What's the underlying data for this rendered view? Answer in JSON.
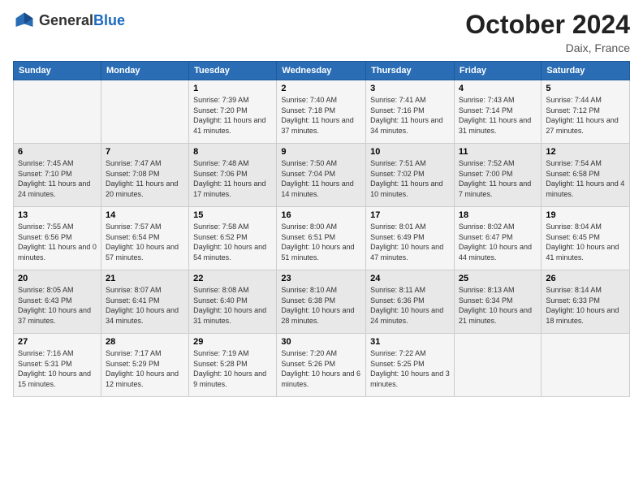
{
  "header": {
    "logo_line1": "General",
    "logo_line2": "Blue",
    "month": "October 2024",
    "location": "Daix, France"
  },
  "days_of_week": [
    "Sunday",
    "Monday",
    "Tuesday",
    "Wednesday",
    "Thursday",
    "Friday",
    "Saturday"
  ],
  "weeks": [
    [
      {
        "num": "",
        "sunrise": "",
        "sunset": "",
        "daylight": ""
      },
      {
        "num": "",
        "sunrise": "",
        "sunset": "",
        "daylight": ""
      },
      {
        "num": "1",
        "sunrise": "Sunrise: 7:39 AM",
        "sunset": "Sunset: 7:20 PM",
        "daylight": "Daylight: 11 hours and 41 minutes."
      },
      {
        "num": "2",
        "sunrise": "Sunrise: 7:40 AM",
        "sunset": "Sunset: 7:18 PM",
        "daylight": "Daylight: 11 hours and 37 minutes."
      },
      {
        "num": "3",
        "sunrise": "Sunrise: 7:41 AM",
        "sunset": "Sunset: 7:16 PM",
        "daylight": "Daylight: 11 hours and 34 minutes."
      },
      {
        "num": "4",
        "sunrise": "Sunrise: 7:43 AM",
        "sunset": "Sunset: 7:14 PM",
        "daylight": "Daylight: 11 hours and 31 minutes."
      },
      {
        "num": "5",
        "sunrise": "Sunrise: 7:44 AM",
        "sunset": "Sunset: 7:12 PM",
        "daylight": "Daylight: 11 hours and 27 minutes."
      }
    ],
    [
      {
        "num": "6",
        "sunrise": "Sunrise: 7:45 AM",
        "sunset": "Sunset: 7:10 PM",
        "daylight": "Daylight: 11 hours and 24 minutes."
      },
      {
        "num": "7",
        "sunrise": "Sunrise: 7:47 AM",
        "sunset": "Sunset: 7:08 PM",
        "daylight": "Daylight: 11 hours and 20 minutes."
      },
      {
        "num": "8",
        "sunrise": "Sunrise: 7:48 AM",
        "sunset": "Sunset: 7:06 PM",
        "daylight": "Daylight: 11 hours and 17 minutes."
      },
      {
        "num": "9",
        "sunrise": "Sunrise: 7:50 AM",
        "sunset": "Sunset: 7:04 PM",
        "daylight": "Daylight: 11 hours and 14 minutes."
      },
      {
        "num": "10",
        "sunrise": "Sunrise: 7:51 AM",
        "sunset": "Sunset: 7:02 PM",
        "daylight": "Daylight: 11 hours and 10 minutes."
      },
      {
        "num": "11",
        "sunrise": "Sunrise: 7:52 AM",
        "sunset": "Sunset: 7:00 PM",
        "daylight": "Daylight: 11 hours and 7 minutes."
      },
      {
        "num": "12",
        "sunrise": "Sunrise: 7:54 AM",
        "sunset": "Sunset: 6:58 PM",
        "daylight": "Daylight: 11 hours and 4 minutes."
      }
    ],
    [
      {
        "num": "13",
        "sunrise": "Sunrise: 7:55 AM",
        "sunset": "Sunset: 6:56 PM",
        "daylight": "Daylight: 11 hours and 0 minutes."
      },
      {
        "num": "14",
        "sunrise": "Sunrise: 7:57 AM",
        "sunset": "Sunset: 6:54 PM",
        "daylight": "Daylight: 10 hours and 57 minutes."
      },
      {
        "num": "15",
        "sunrise": "Sunrise: 7:58 AM",
        "sunset": "Sunset: 6:52 PM",
        "daylight": "Daylight: 10 hours and 54 minutes."
      },
      {
        "num": "16",
        "sunrise": "Sunrise: 8:00 AM",
        "sunset": "Sunset: 6:51 PM",
        "daylight": "Daylight: 10 hours and 51 minutes."
      },
      {
        "num": "17",
        "sunrise": "Sunrise: 8:01 AM",
        "sunset": "Sunset: 6:49 PM",
        "daylight": "Daylight: 10 hours and 47 minutes."
      },
      {
        "num": "18",
        "sunrise": "Sunrise: 8:02 AM",
        "sunset": "Sunset: 6:47 PM",
        "daylight": "Daylight: 10 hours and 44 minutes."
      },
      {
        "num": "19",
        "sunrise": "Sunrise: 8:04 AM",
        "sunset": "Sunset: 6:45 PM",
        "daylight": "Daylight: 10 hours and 41 minutes."
      }
    ],
    [
      {
        "num": "20",
        "sunrise": "Sunrise: 8:05 AM",
        "sunset": "Sunset: 6:43 PM",
        "daylight": "Daylight: 10 hours and 37 minutes."
      },
      {
        "num": "21",
        "sunrise": "Sunrise: 8:07 AM",
        "sunset": "Sunset: 6:41 PM",
        "daylight": "Daylight: 10 hours and 34 minutes."
      },
      {
        "num": "22",
        "sunrise": "Sunrise: 8:08 AM",
        "sunset": "Sunset: 6:40 PM",
        "daylight": "Daylight: 10 hours and 31 minutes."
      },
      {
        "num": "23",
        "sunrise": "Sunrise: 8:10 AM",
        "sunset": "Sunset: 6:38 PM",
        "daylight": "Daylight: 10 hours and 28 minutes."
      },
      {
        "num": "24",
        "sunrise": "Sunrise: 8:11 AM",
        "sunset": "Sunset: 6:36 PM",
        "daylight": "Daylight: 10 hours and 24 minutes."
      },
      {
        "num": "25",
        "sunrise": "Sunrise: 8:13 AM",
        "sunset": "Sunset: 6:34 PM",
        "daylight": "Daylight: 10 hours and 21 minutes."
      },
      {
        "num": "26",
        "sunrise": "Sunrise: 8:14 AM",
        "sunset": "Sunset: 6:33 PM",
        "daylight": "Daylight: 10 hours and 18 minutes."
      }
    ],
    [
      {
        "num": "27",
        "sunrise": "Sunrise: 7:16 AM",
        "sunset": "Sunset: 5:31 PM",
        "daylight": "Daylight: 10 hours and 15 minutes."
      },
      {
        "num": "28",
        "sunrise": "Sunrise: 7:17 AM",
        "sunset": "Sunset: 5:29 PM",
        "daylight": "Daylight: 10 hours and 12 minutes."
      },
      {
        "num": "29",
        "sunrise": "Sunrise: 7:19 AM",
        "sunset": "Sunset: 5:28 PM",
        "daylight": "Daylight: 10 hours and 9 minutes."
      },
      {
        "num": "30",
        "sunrise": "Sunrise: 7:20 AM",
        "sunset": "Sunset: 5:26 PM",
        "daylight": "Daylight: 10 hours and 6 minutes."
      },
      {
        "num": "31",
        "sunrise": "Sunrise: 7:22 AM",
        "sunset": "Sunset: 5:25 PM",
        "daylight": "Daylight: 10 hours and 3 minutes."
      },
      {
        "num": "",
        "sunrise": "",
        "sunset": "",
        "daylight": ""
      },
      {
        "num": "",
        "sunrise": "",
        "sunset": "",
        "daylight": ""
      }
    ]
  ]
}
